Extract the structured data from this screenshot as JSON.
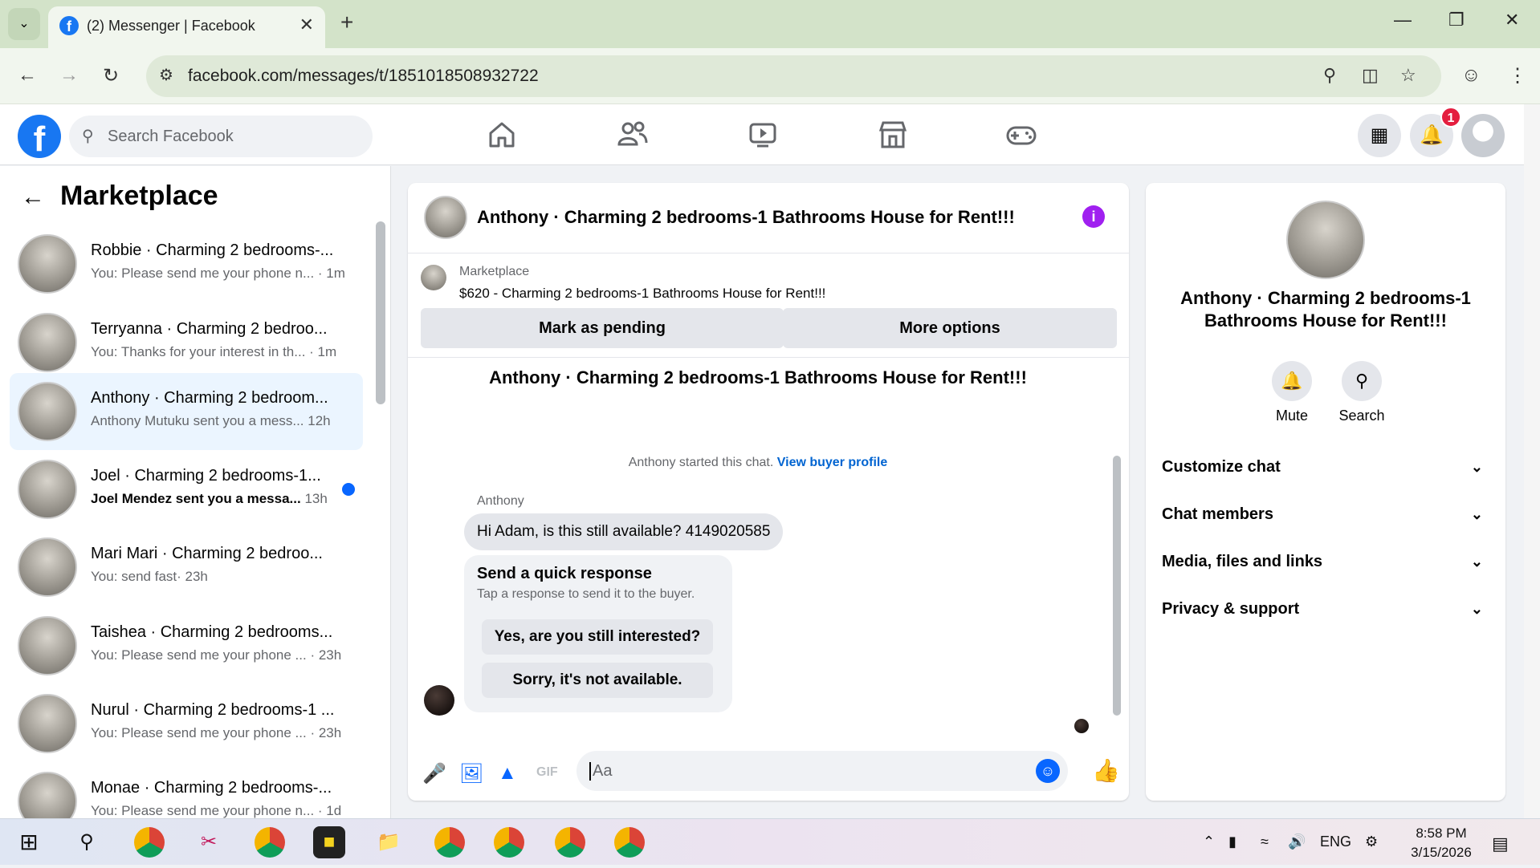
{
  "browser": {
    "tab_title": "(2) Messenger | Facebook",
    "url": "facebook.com/messages/t/1851018508932722"
  },
  "fb": {
    "search_placeholder": "Search Facebook",
    "notification_count": "1"
  },
  "left": {
    "heading": "Marketplace",
    "conversations": [
      {
        "name": "Robbie · Charming 2 bedrooms-...",
        "snippet": "You: Please send me your phone n...",
        "time": "· 1m",
        "unread": false
      },
      {
        "name": "Terryanna · Charming 2 bedroo...",
        "snippet": "You: Thanks for your interest in th...",
        "time": "· 1m",
        "unread": false
      },
      {
        "name": "Anthony · Charming 2 bedroom...",
        "snippet": "Anthony Mutuku sent you a mess...",
        "time": "12h",
        "unread": false
      },
      {
        "name": "Joel · Charming 2 bedrooms-1...",
        "snippet": "Joel Mendez sent you a messa...",
        "time": "13h",
        "unread": true
      },
      {
        "name": "Mari Mari · Charming 2 bedroo...",
        "snippet": "You: send fast",
        "time": "· 23h",
        "unread": false
      },
      {
        "name": "Taishea · Charming 2 bedrooms...",
        "snippet": "You: Please send me your phone ...",
        "time": "· 23h",
        "unread": false
      },
      {
        "name": "Nurul · Charming 2 bedrooms-1 ...",
        "snippet": "You: Please send me your phone ...",
        "time": "· 23h",
        "unread": false
      },
      {
        "name": "Monae · Charming 2 bedrooms-...",
        "snippet": "You: Please send me your phone n...",
        "time": "· 1d",
        "unread": false
      }
    ]
  },
  "chat": {
    "title": "Anthony · Charming 2 bedrooms-1 Bathrooms House for Rent!!!",
    "marketplace_label": "Marketplace",
    "listing": "$620 - Charming 2 bedrooms-1 Bathrooms House for Rent!!!",
    "mark_pending": "Mark as pending",
    "more_options": "More options",
    "conv_title": "Anthony · Charming 2 bedrooms-1 Bathrooms House for Rent!!!",
    "started_text": "Anthony started this chat.",
    "view_profile": "View buyer profile",
    "sender": "Anthony",
    "message": "Hi Adam, is this still available? 4149020585",
    "quick_heading": "Send a quick response",
    "quick_sub": "Tap a response to send it to the buyer.",
    "quick_1": "Yes, are you still interested?",
    "quick_2": "Sorry, it's not available.",
    "composer_placeholder": "Aa"
  },
  "right": {
    "title": "Anthony · Charming 2 bedrooms-1 Bathrooms House for Rent!!!",
    "mute": "Mute",
    "search": "Search",
    "sections": [
      "Customize chat",
      "Chat members",
      "Media, files and links",
      "Privacy & support"
    ]
  },
  "taskbar": {
    "lang": "ENG",
    "time": "8:58 PM",
    "date": "3/15/2026"
  }
}
